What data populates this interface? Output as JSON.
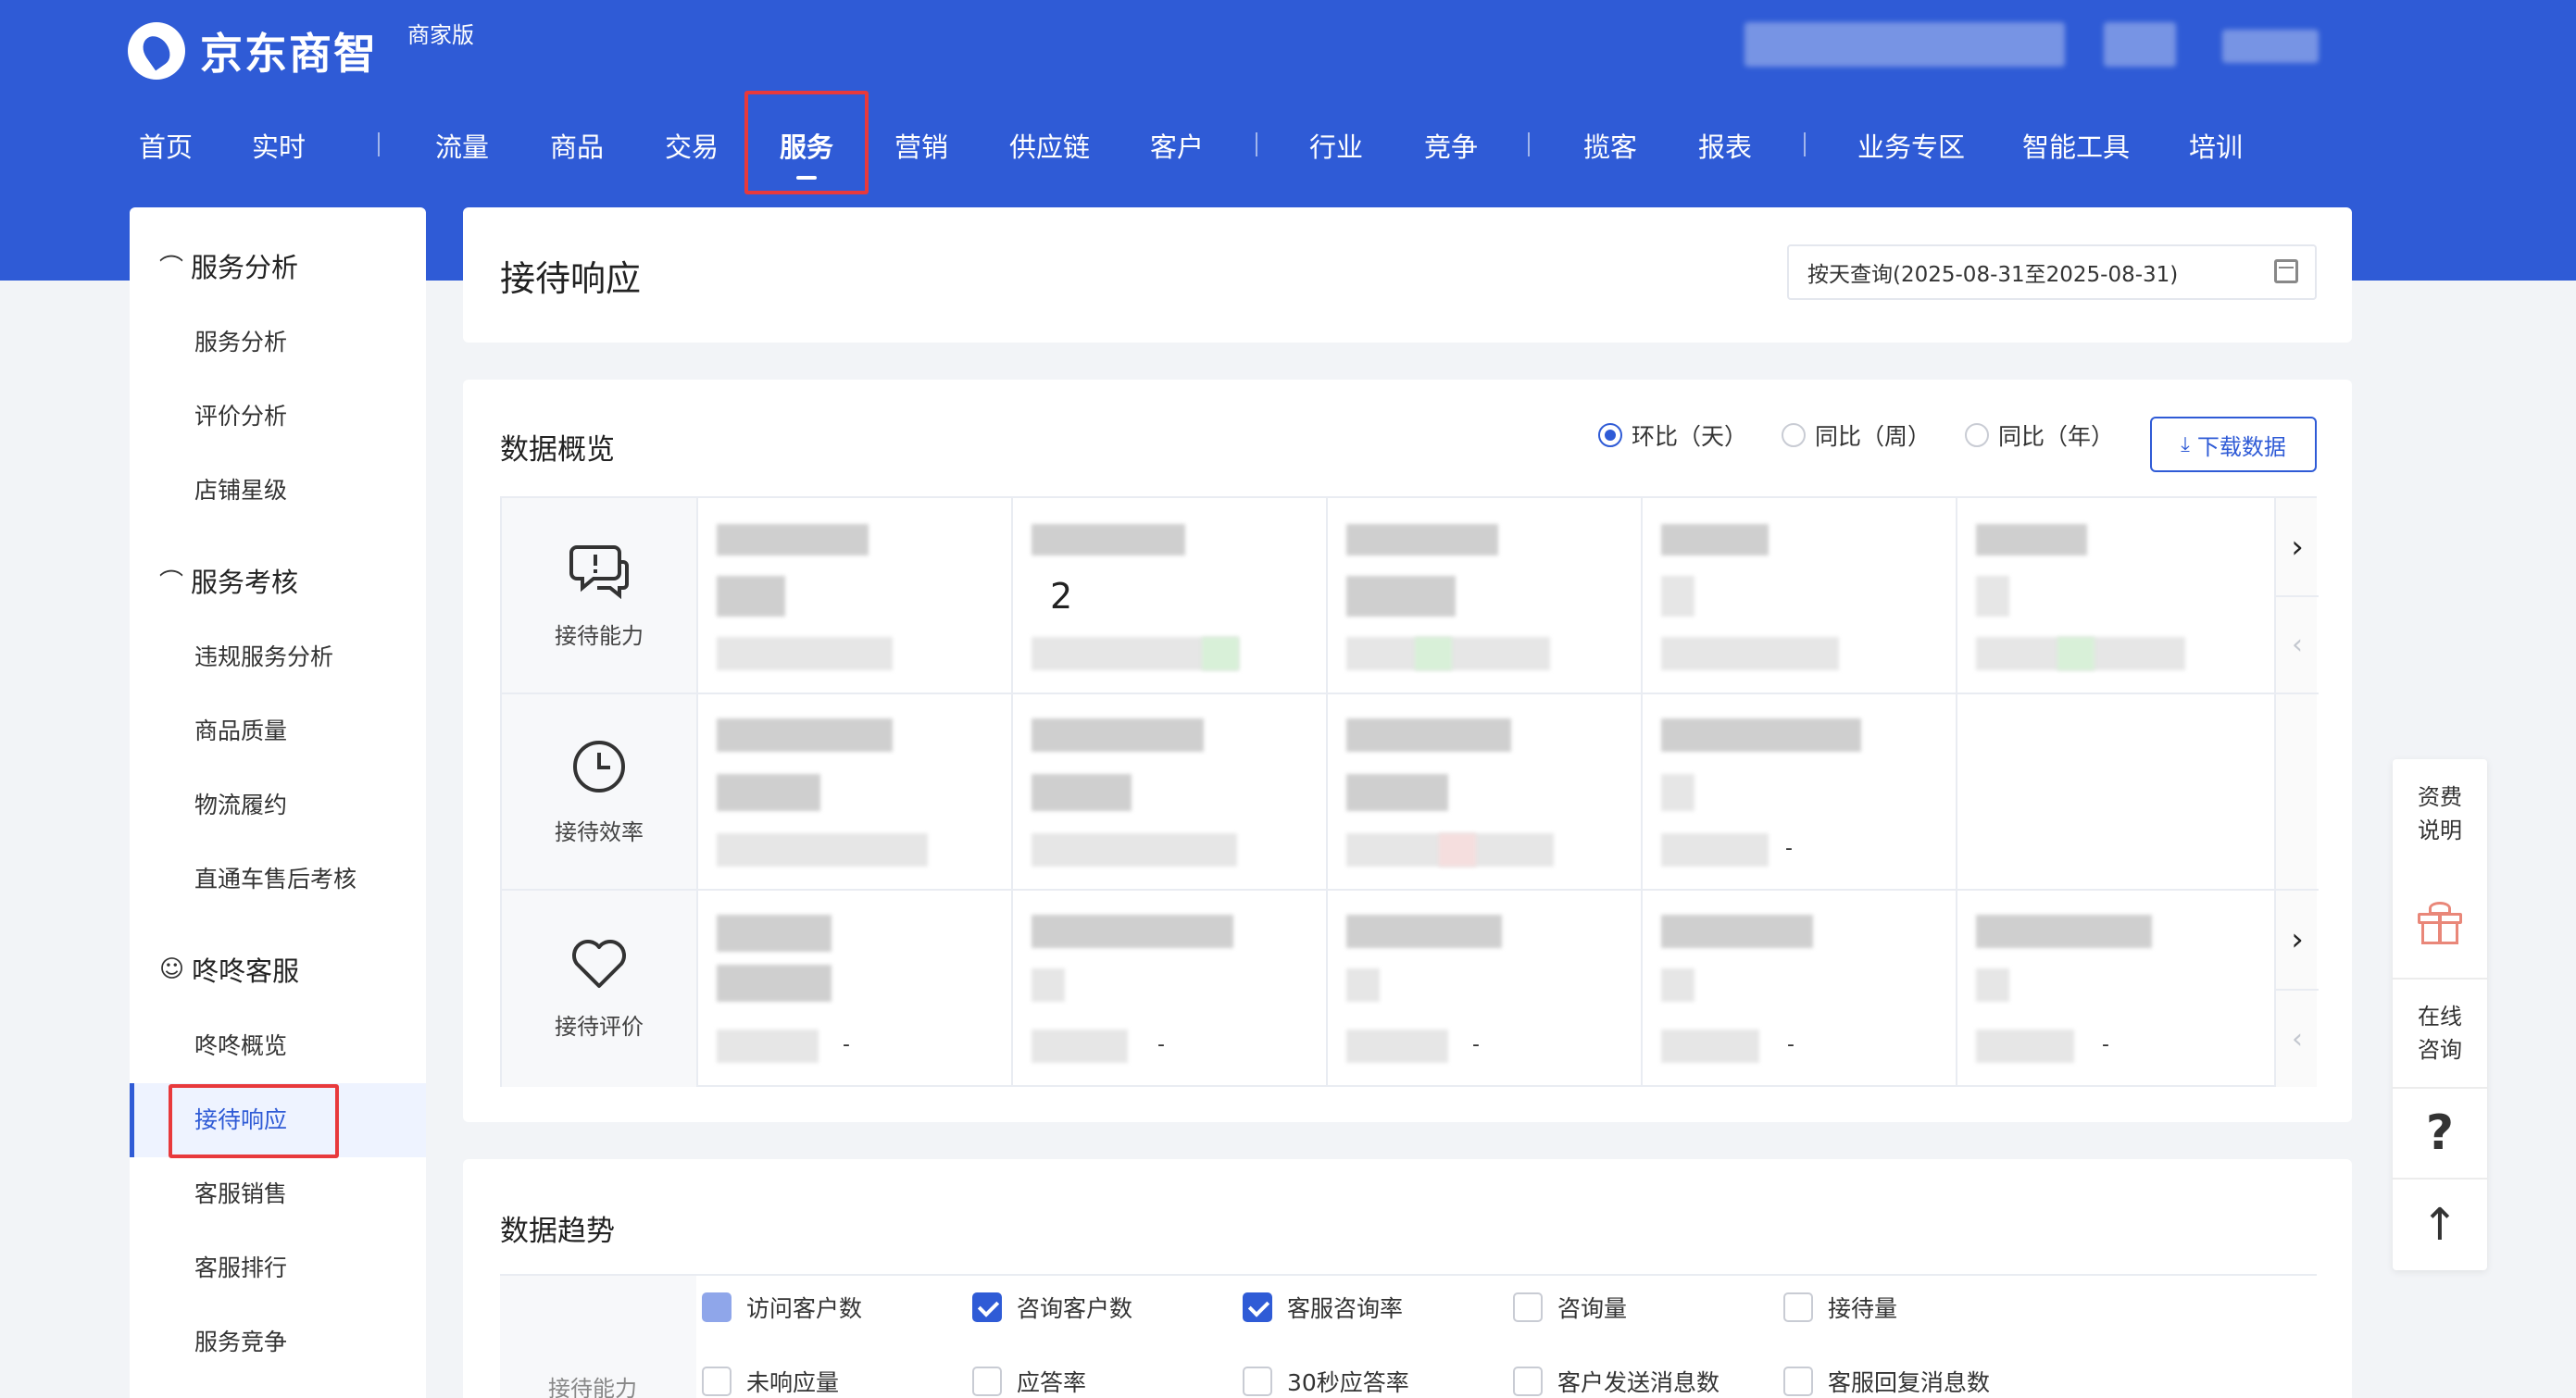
{
  "header": {
    "logo_text": "京东商智",
    "edition": "商家版",
    "nav": [
      {
        "label": "首页"
      },
      {
        "label": "实时"
      },
      {
        "sep": true
      },
      {
        "label": "流量"
      },
      {
        "label": "商品"
      },
      {
        "label": "交易"
      },
      {
        "label": "服务",
        "active": true
      },
      {
        "label": "营销"
      },
      {
        "label": "供应链"
      },
      {
        "label": "客户"
      },
      {
        "sep": true
      },
      {
        "label": "行业"
      },
      {
        "label": "竞争"
      },
      {
        "sep": true
      },
      {
        "label": "揽客"
      },
      {
        "label": "报表"
      },
      {
        "sep": true
      },
      {
        "label": "业务专区"
      },
      {
        "label": "智能工具"
      },
      {
        "label": "培训"
      }
    ]
  },
  "sidebar": {
    "groups": [
      {
        "title": "服务分析",
        "icon": "headset-icon",
        "items": [
          "服务分析",
          "评价分析",
          "店铺星级"
        ]
      },
      {
        "title": "服务考核",
        "icon": "headset-icon",
        "items": [
          "违规服务分析",
          "商品质量",
          "物流履约",
          "直通车售后考核"
        ]
      },
      {
        "title": "咚咚客服",
        "icon": "chat-icon",
        "items": [
          "咚咚概览",
          "接待响应",
          "客服销售",
          "客服排行",
          "服务竞争"
        ]
      }
    ],
    "active_item": "接待响应"
  },
  "page": {
    "title": "接待响应",
    "date_query": "按天查询(2025-08-31至2025-08-31)"
  },
  "overview": {
    "title": "数据概览",
    "compare_options": [
      {
        "label": "环比（天）",
        "selected": true
      },
      {
        "label": "同比（周）",
        "selected": false
      },
      {
        "label": "同比（年）",
        "selected": false
      }
    ],
    "download_label": "下载数据",
    "rows": [
      {
        "label": "接待能力",
        "icon": "chat-bubble-icon",
        "glyph": "💬"
      },
      {
        "label": "接待效率",
        "icon": "clock-icon",
        "glyph": "◷"
      },
      {
        "label": "接待评价",
        "icon": "heart-icon",
        "glyph": "♡"
      }
    ],
    "visible_value": "2",
    "dash": "-"
  },
  "trend": {
    "title": "数据趋势",
    "row_label": "接待能力",
    "metrics_row1": [
      {
        "label": "访问客户数",
        "state": "partial"
      },
      {
        "label": "咨询客户数",
        "state": "checked"
      },
      {
        "label": "客服咨询率",
        "state": "checked"
      },
      {
        "label": "咨询量",
        "state": "unchecked"
      },
      {
        "label": "接待量",
        "state": "unchecked"
      }
    ],
    "metrics_row2": [
      {
        "label": "未响应量",
        "state": "unchecked"
      },
      {
        "label": "应答率",
        "state": "unchecked"
      },
      {
        "label": "30秒应答率",
        "state": "unchecked"
      },
      {
        "label": "客户发送消息数",
        "state": "unchecked"
      },
      {
        "label": "客服回复消息数",
        "state": "unchecked"
      }
    ]
  },
  "float_panel": {
    "fee_label_1": "资费",
    "fee_label_2": "说明",
    "consult_label_1": "在线",
    "consult_label_2": "咨询",
    "help_label": "?",
    "top_label": "↑"
  }
}
